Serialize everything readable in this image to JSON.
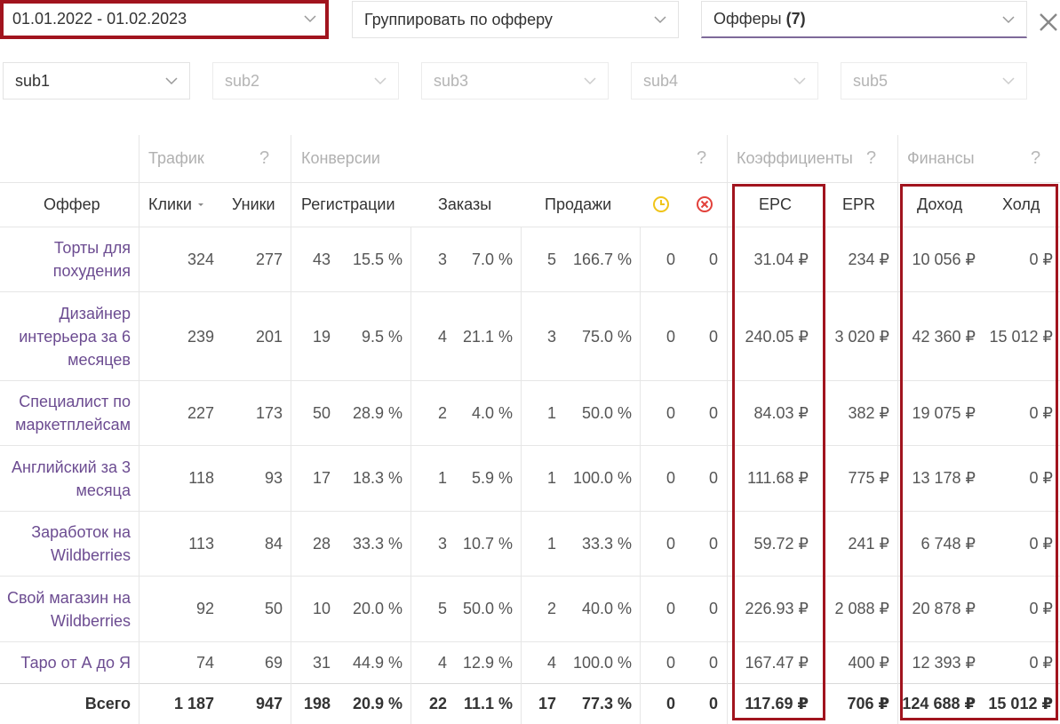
{
  "filters": {
    "date_range": "01.01.2022 - 01.02.2023",
    "group_by": "Группировать по офферу",
    "offers_label": "Офферы",
    "offers_count": "(7)",
    "subs": [
      "sub1",
      "sub2",
      "sub3",
      "sub4",
      "sub5"
    ]
  },
  "groups": {
    "traffic": "Трафик",
    "conversions": "Конверсии",
    "coefficients": "Коэффициенты",
    "finance": "Финансы",
    "help": "?"
  },
  "columns": {
    "offer": "Оффер",
    "clicks": "Клики",
    "uniques": "Уники",
    "registrations": "Регистрации",
    "orders": "Заказы",
    "sales": "Продажи",
    "epc": "EPC",
    "epr": "EPR",
    "income": "Доход",
    "hold": "Холд"
  },
  "rows": [
    {
      "offer": "Торты для похудения",
      "clicks": "324",
      "uniques": "277",
      "reg": "43",
      "reg_pct": "15.5 %",
      "ord": "3",
      "ord_pct": "7.0 %",
      "sal": "5",
      "sal_pct": "166.7 %",
      "pending": "0",
      "rejected": "0",
      "epc": "31.04 ₽",
      "epr": "234 ₽",
      "income": "10 056 ₽",
      "hold": "0 ₽"
    },
    {
      "offer": "Дизайнер интерьера за 6 месяцев",
      "clicks": "239",
      "uniques": "201",
      "reg": "19",
      "reg_pct": "9.5 %",
      "ord": "4",
      "ord_pct": "21.1 %",
      "sal": "3",
      "sal_pct": "75.0 %",
      "pending": "0",
      "rejected": "0",
      "epc": "240.05 ₽",
      "epr": "3 020 ₽",
      "income": "42 360 ₽",
      "hold": "15 012 ₽"
    },
    {
      "offer": "Специалист по маркетплейсам",
      "clicks": "227",
      "uniques": "173",
      "reg": "50",
      "reg_pct": "28.9 %",
      "ord": "2",
      "ord_pct": "4.0 %",
      "sal": "1",
      "sal_pct": "50.0 %",
      "pending": "0",
      "rejected": "0",
      "epc": "84.03 ₽",
      "epr": "382 ₽",
      "income": "19 075 ₽",
      "hold": "0 ₽"
    },
    {
      "offer": "Английский за 3 месяца",
      "clicks": "118",
      "uniques": "93",
      "reg": "17",
      "reg_pct": "18.3 %",
      "ord": "1",
      "ord_pct": "5.9 %",
      "sal": "1",
      "sal_pct": "100.0 %",
      "pending": "0",
      "rejected": "0",
      "epc": "111.68 ₽",
      "epr": "775 ₽",
      "income": "13 178 ₽",
      "hold": "0 ₽"
    },
    {
      "offer": "Заработок на Wildberries",
      "clicks": "113",
      "uniques": "84",
      "reg": "28",
      "reg_pct": "33.3 %",
      "ord": "3",
      "ord_pct": "10.7 %",
      "sal": "1",
      "sal_pct": "33.3 %",
      "pending": "0",
      "rejected": "0",
      "epc": "59.72 ₽",
      "epr": "241 ₽",
      "income": "6 748 ₽",
      "hold": "0 ₽"
    },
    {
      "offer": "Свой магазин на Wildberries",
      "clicks": "92",
      "uniques": "50",
      "reg": "10",
      "reg_pct": "20.0 %",
      "ord": "5",
      "ord_pct": "50.0 %",
      "sal": "2",
      "sal_pct": "40.0 %",
      "pending": "0",
      "rejected": "0",
      "epc": "226.93 ₽",
      "epr": "2 088 ₽",
      "income": "20 878 ₽",
      "hold": "0 ₽"
    },
    {
      "offer": "Таро от А до Я",
      "clicks": "74",
      "uniques": "69",
      "reg": "31",
      "reg_pct": "44.9 %",
      "ord": "4",
      "ord_pct": "12.9 %",
      "sal": "4",
      "sal_pct": "100.0 %",
      "pending": "0",
      "rejected": "0",
      "epc": "167.47 ₽",
      "epr": "400 ₽",
      "income": "12 393 ₽",
      "hold": "0 ₽"
    }
  ],
  "total": {
    "offer": "Всего",
    "clicks": "1 187",
    "uniques": "947",
    "reg": "198",
    "reg_pct": "20.9 %",
    "ord": "22",
    "ord_pct": "11.1 %",
    "sal": "17",
    "sal_pct": "77.3 %",
    "pending": "0",
    "rejected": "0",
    "epc": "117.69 ₽",
    "epr": "706 ₽",
    "income": "124 688 ₽",
    "hold": "15 012 ₽"
  },
  "colors": {
    "accent": "#6c4c91",
    "highlight": "#a1141e",
    "pending_icon": "#f0c419",
    "rejected_icon": "#e2413b"
  }
}
